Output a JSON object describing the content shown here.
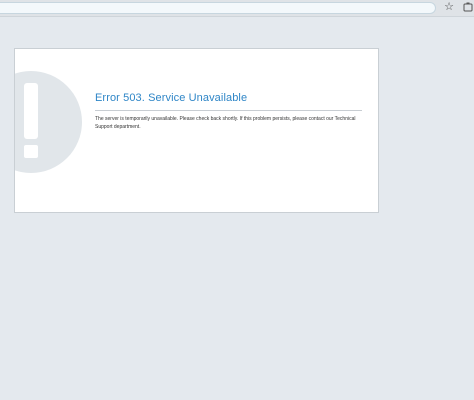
{
  "browser": {
    "star_icon": "star-outline-icon",
    "extension_icon": "extension-icon"
  },
  "error": {
    "title": "Error 503. Service Unavailable",
    "message": "The server is temporarily unavailable. Please check back shortly. If this problem persists, please contact our Technical Support department.",
    "graphic_icon": "exclamation-circle-icon"
  },
  "colors": {
    "page_background": "#e4e9ee",
    "title_blue": "#2f86c7",
    "graphic_gray": "#e1e6ea"
  }
}
